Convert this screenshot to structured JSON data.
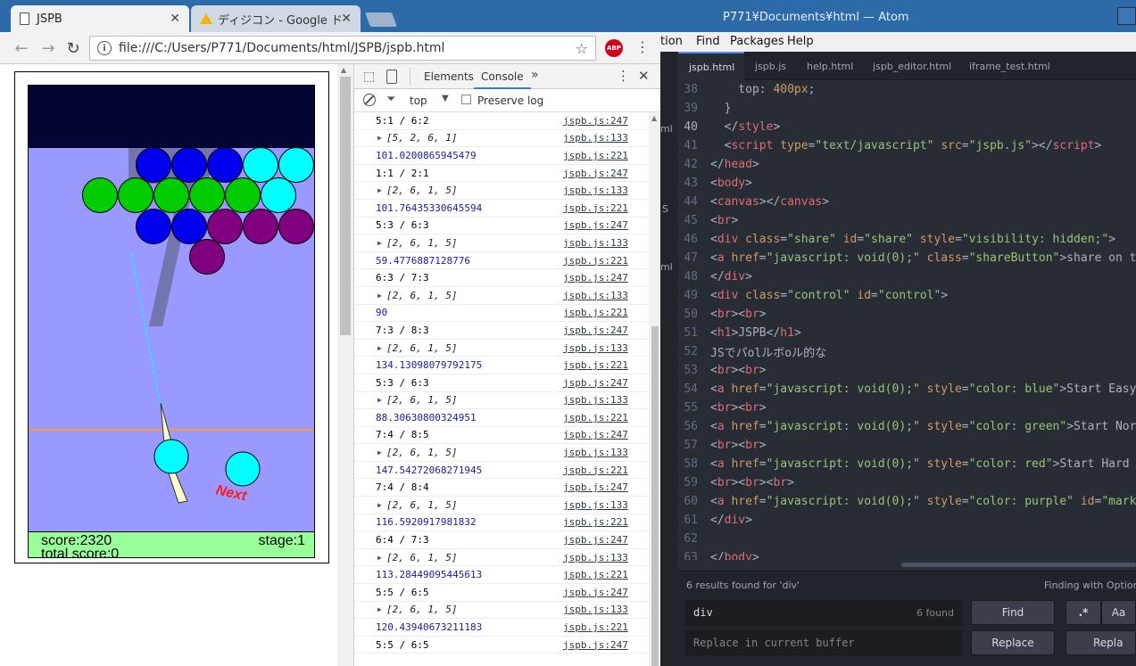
{
  "browser": {
    "tabs": [
      {
        "title": "JSPB",
        "active": true
      },
      {
        "title": "ディジコン - Google ド",
        "active": false
      }
    ],
    "url": "file:///C:/Users/P771/Documents/html/JSPB/jspb.html",
    "abp_label": "ABP"
  },
  "game": {
    "score": "score:2320",
    "total_score": "total score:0",
    "stage": "stage:1",
    "next_label": "Next",
    "colors": {
      "sky": "#9999ff",
      "top": "#050533",
      "status": "#99ff99",
      "blue": "#0000ee",
      "green": "#00cc00",
      "cyan": "#00ffff",
      "purple": "#800080"
    }
  },
  "devtools": {
    "tabs": [
      "Elements",
      "Console"
    ],
    "active_tab": "Console",
    "context": "top",
    "preserve_log": "Preserve log",
    "console_rows": [
      {
        "type": "text",
        "msg": "5:1 / 6:2",
        "src": "jspb.js:247"
      },
      {
        "type": "arr",
        "msg": "[5, 2, 6, 1]",
        "src": "jspb.js:133"
      },
      {
        "type": "num",
        "msg": "101.0200865945479",
        "src": "jspb.js:221"
      },
      {
        "type": "text",
        "msg": "1:1 / 2:1",
        "src": "jspb.js:247"
      },
      {
        "type": "arr",
        "msg": "[2, 6, 1, 5]",
        "src": "jspb.js:133"
      },
      {
        "type": "num",
        "msg": "101.76435330645594",
        "src": "jspb.js:221"
      },
      {
        "type": "text",
        "msg": "5:3 / 6:3",
        "src": "jspb.js:247"
      },
      {
        "type": "arr",
        "msg": "[2, 6, 1, 5]",
        "src": "jspb.js:133"
      },
      {
        "type": "num",
        "msg": "59.4776887128776",
        "src": "jspb.js:221"
      },
      {
        "type": "text",
        "msg": "6:3 / 7:3",
        "src": "jspb.js:247"
      },
      {
        "type": "arr",
        "msg": "[2, 6, 1, 5]",
        "src": "jspb.js:133"
      },
      {
        "type": "num",
        "msg": "90",
        "src": "jspb.js:221"
      },
      {
        "type": "text",
        "msg": "7:3 / 8:3",
        "src": "jspb.js:247"
      },
      {
        "type": "arr",
        "msg": "[2, 6, 1, 5]",
        "src": "jspb.js:133"
      },
      {
        "type": "num",
        "msg": "134.13098079792175",
        "src": "jspb.js:221"
      },
      {
        "type": "text",
        "msg": "5:3 / 6:3",
        "src": "jspb.js:247"
      },
      {
        "type": "arr",
        "msg": "[2, 6, 1, 5]",
        "src": "jspb.js:133"
      },
      {
        "type": "num",
        "msg": "88.30630800324951",
        "src": "jspb.js:221"
      },
      {
        "type": "text",
        "msg": "7:4 / 8:5",
        "src": "jspb.js:247"
      },
      {
        "type": "arr",
        "msg": "[2, 6, 1, 5]",
        "src": "jspb.js:133"
      },
      {
        "type": "num",
        "msg": "147.54272068271945",
        "src": "jspb.js:221"
      },
      {
        "type": "text",
        "msg": "7:4 / 8:4",
        "src": "jspb.js:247"
      },
      {
        "type": "arr",
        "msg": "[2, 6, 1, 5]",
        "src": "jspb.js:133"
      },
      {
        "type": "num",
        "msg": "116.5920917981832",
        "src": "jspb.js:221"
      },
      {
        "type": "text",
        "msg": "6:4 / 7:3",
        "src": "jspb.js:247"
      },
      {
        "type": "arr",
        "msg": "[2, 6, 1, 5]",
        "src": "jspb.js:133"
      },
      {
        "type": "num",
        "msg": "113.28449095445613",
        "src": "jspb.js:221"
      },
      {
        "type": "text",
        "msg": "5:5 / 6:5",
        "src": "jspb.js:247"
      },
      {
        "type": "arr",
        "msg": "[2, 6, 1, 5]",
        "src": "jspb.js:133"
      },
      {
        "type": "num",
        "msg": "120.43940673211183",
        "src": "jspb.js:221"
      },
      {
        "type": "text",
        "msg": "5:5 / 6:5",
        "src": "jspb.js:247"
      }
    ]
  },
  "atom": {
    "title": "P771¥Documents¥html — Atom",
    "menu": [
      "tion",
      "Find",
      "Packages",
      "Help"
    ],
    "tabs": [
      "jspb.html",
      "jspb.js",
      "help.html",
      "jspb_editor.html",
      "iframe_test.html"
    ],
    "active_tab": "jspb.html",
    "current_line": "40",
    "lines": [
      {
        "n": "38",
        "html": "<span class=\"p\">    top: </span><span class=\"a\">400px</span><span class=\"p\">;</span>"
      },
      {
        "n": "39",
        "html": "<span class=\"p\">  }</span>"
      },
      {
        "n": "40",
        "html": "<span class=\"p\">  &lt;/</span><span class=\"t\">style</span><span class=\"p\">&gt;</span>"
      },
      {
        "n": "41",
        "html": "<span class=\"p\">  &lt;</span><span class=\"t\">script</span> <span class=\"a\">type</span>=<span class=\"s\">\"text/javascript\"</span> <span class=\"a\">src</span>=<span class=\"s\">\"jspb.js\"</span><span class=\"p\">&gt;&lt;/</span><span class=\"t\">script</span><span class=\"p\">&gt;</span>"
      },
      {
        "n": "42",
        "html": "<span class=\"p\">&lt;/</span><span class=\"t\">head</span><span class=\"p\">&gt;</span>"
      },
      {
        "n": "43",
        "html": "<span class=\"p\">&lt;</span><span class=\"t\">body</span><span class=\"p\">&gt;</span>"
      },
      {
        "n": "44",
        "html": "<span class=\"p\">&lt;</span><span class=\"t\">canvas</span><span class=\"p\">&gt;&lt;/</span><span class=\"t\">canvas</span><span class=\"p\">&gt;</span>"
      },
      {
        "n": "45",
        "html": "<span class=\"p\">&lt;</span><span class=\"t\">br</span><span class=\"p\">&gt;</span>"
      },
      {
        "n": "46",
        "html": "<span class=\"p\">&lt;</span><span class=\"t\">div</span> <span class=\"a\">class</span>=<span class=\"s\">\"share\"</span> <span class=\"a\">id</span>=<span class=\"s\">\"share\"</span> <span class=\"a\">style</span>=<span class=\"s\">\"visibility: hidden;\"</span><span class=\"p\">&gt;</span>"
      },
      {
        "n": "47",
        "html": "<span class=\"p\">&lt;</span><span class=\"t\">a</span> <span class=\"a\">href</span>=<span class=\"s\">\"javascript: void(0);\"</span> <span class=\"a\">class</span>=<span class=\"s\">\"shareButton\"</span><span class=\"p\">&gt;share on t</span>"
      },
      {
        "n": "48",
        "html": "<span class=\"p\">&lt;/</span><span class=\"t\">div</span><span class=\"p\">&gt;</span>"
      },
      {
        "n": "49",
        "html": "<span class=\"p\">&lt;</span><span class=\"t\">div</span> <span class=\"a\">class</span>=<span class=\"s\">\"control\"</span> <span class=\"a\">id</span>=<span class=\"s\">\"control\"</span><span class=\"p\">&gt;</span>"
      },
      {
        "n": "50",
        "html": "<span class=\"p\">&lt;</span><span class=\"t\">br</span><span class=\"p\">&gt;&lt;</span><span class=\"t\">br</span><span class=\"p\">&gt;</span>"
      },
      {
        "n": "51",
        "html": "<span class=\"p\">&lt;</span><span class=\"t\">h1</span><span class=\"p\">&gt;JSPB&lt;/</span><span class=\"t\">h1</span><span class=\"p\">&gt;</span>"
      },
      {
        "n": "52",
        "html": "<span class=\"p\">JSでパolルボoル的な</span>"
      },
      {
        "n": "53",
        "html": "<span class=\"p\">&lt;</span><span class=\"t\">br</span><span class=\"p\">&gt;&lt;</span><span class=\"t\">br</span><span class=\"p\">&gt;</span>"
      },
      {
        "n": "54",
        "html": "<span class=\"p\">&lt;</span><span class=\"t\">a</span> <span class=\"a\">href</span>=<span class=\"s\">\"javascript: void(0);\"</span> <span class=\"a\">style</span>=<span class=\"s\">\"color: blue\"</span><span class=\"p\">&gt;Start Easy</span>"
      },
      {
        "n": "55",
        "html": "<span class=\"p\">&lt;</span><span class=\"t\">br</span><span class=\"p\">&gt;&lt;</span><span class=\"t\">br</span><span class=\"p\">&gt;</span>"
      },
      {
        "n": "56",
        "html": "<span class=\"p\">&lt;</span><span class=\"t\">a</span> <span class=\"a\">href</span>=<span class=\"s\">\"javascript: void(0);\"</span> <span class=\"a\">style</span>=<span class=\"s\">\"color: green\"</span><span class=\"p\">&gt;Start Nor</span>"
      },
      {
        "n": "57",
        "html": "<span class=\"p\">&lt;</span><span class=\"t\">br</span><span class=\"p\">&gt;&lt;</span><span class=\"t\">br</span><span class=\"p\">&gt;</span>"
      },
      {
        "n": "58",
        "html": "<span class=\"p\">&lt;</span><span class=\"t\">a</span> <span class=\"a\">href</span>=<span class=\"s\">\"javascript: void(0);\"</span> <span class=\"a\">style</span>=<span class=\"s\">\"color: red\"</span><span class=\"p\">&gt;Start Hard </span>"
      },
      {
        "n": "59",
        "html": "<span class=\"p\">&lt;</span><span class=\"t\">br</span><span class=\"p\">&gt;&lt;</span><span class=\"t\">br</span><span class=\"p\">&gt;&lt;</span><span class=\"t\">br</span><span class=\"p\">&gt;</span>"
      },
      {
        "n": "60",
        "html": "<span class=\"p\">&lt;</span><span class=\"t\">a</span> <span class=\"a\">href</span>=<span class=\"s\">\"javascript: void(0);\"</span> <span class=\"a\">style</span>=<span class=\"s\">\"color: purple\"</span> <span class=\"a\">id</span>=<span class=\"s\">\"mark</span>"
      },
      {
        "n": "61",
        "html": "<span class=\"p\">&lt;/</span><span class=\"t\">div</span><span class=\"p\">&gt;</span>"
      },
      {
        "n": "62",
        "html": ""
      },
      {
        "n": "63",
        "html": "<span class=\"p\">&lt;/</span><span class=\"t\">body</span><span class=\"p\">&gt;</span>"
      }
    ],
    "find": {
      "results_text": "6 results found for 'div'",
      "options_text": "Finding with Options:",
      "query": "div",
      "count": "6 found",
      "find_label": "Find",
      "replace_placeholder": "Replace in current buffer",
      "replace_label": "Replace",
      "replace_all_label": "Repla",
      "regex_label": ".*",
      "case_label": "Aa"
    }
  }
}
